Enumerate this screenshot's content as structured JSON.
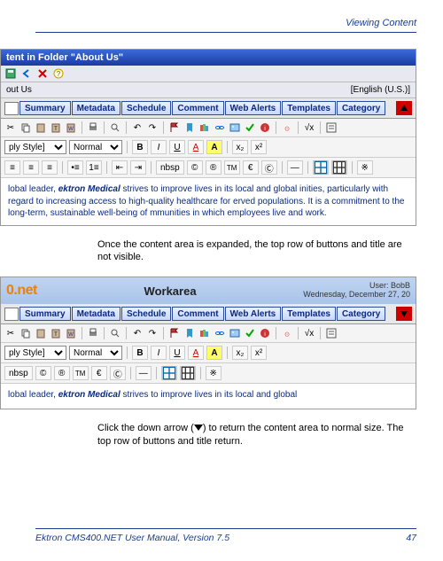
{
  "header": {
    "section": "Viewing Content"
  },
  "shotA": {
    "titlebar": "tent in Folder \"About Us\"",
    "crumb": "out Us",
    "lang": "[English (U.S.)]",
    "tabs": [
      "Summary",
      "Metadata",
      "Schedule",
      "Comment",
      "Web Alerts",
      "Templates",
      "Category"
    ],
    "styleSel": "ply Style]",
    "sizeSel": "Normal",
    "nbsp": "nbsp",
    "content_html": "lobal leader, <em>ektron Medical</em>  strives to improve lives in its local and global inities, particularly with regard to increasing access to high-quality healthcare for erved populations.  It is a commitment to the long-term, sustainable well-being of mmunities in which employees live and work."
  },
  "para1": "Once the content area is expanded, the top row of buttons and title are not visible.",
  "shotB": {
    "brandFrag": "0.net",
    "workarea": "Workarea",
    "userLine1": "User: BobB",
    "userLine2": "Wednesday, December 27, 20",
    "tabs": [
      "Summary",
      "Metadata",
      "Schedule",
      "Comment",
      "Web Alerts",
      "Templates",
      "Category"
    ],
    "styleSel": "ply Style]",
    "sizeSel": "Normal",
    "nbsp": "nbsp",
    "content_html": "lobal leader, <em>ektron Medical</em>  strives to improve lives in its local and global"
  },
  "para2_pre": "Click the down arrow (",
  "para2_post": ") to return the content area to normal size. The top row of buttons and title return.",
  "footer": {
    "left": "Ektron CMS400.NET User Manual, Version 7.5",
    "right": "47"
  }
}
